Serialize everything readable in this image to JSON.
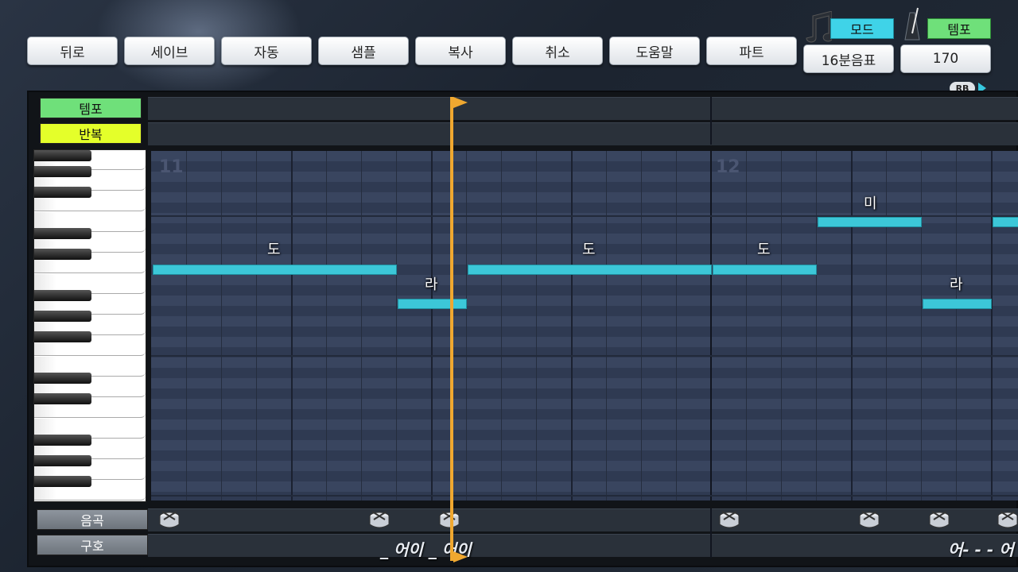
{
  "toolbar": {
    "buttons": [
      "뒤로",
      "세이브",
      "자동",
      "샘플",
      "복사",
      "취소",
      "도움말",
      "파트"
    ]
  },
  "mode": {
    "label": "모드",
    "value": "16분음표"
  },
  "tempo": {
    "label": "템포",
    "value": "170"
  },
  "rb_tag": "RB",
  "tracks": {
    "tempo_label": "템포",
    "repeat_label": "반복",
    "song_label": "음곡",
    "symbol_label": "구호"
  },
  "measures": [
    "11",
    "12"
  ],
  "notes": [
    {
      "label": "도",
      "color": "#3cc7d8"
    },
    {
      "label": "라",
      "color": "#3cc7d8"
    },
    {
      "label": "도",
      "color": "#3cc7d8"
    },
    {
      "label": "도",
      "color": "#3cc7d8"
    },
    {
      "label": "미",
      "color": "#3cc7d8"
    },
    {
      "label": "라",
      "color": "#3cc7d8"
    }
  ],
  "lyrics": [
    "_ 어이 _ 어이",
    "어- - - 어"
  ],
  "colors": {
    "accent_cyan": "#3fd3e8",
    "accent_green": "#6fe07a",
    "accent_yellow": "#e4ff2a",
    "playhead": "#f0a830"
  },
  "icons": [
    "note-icon",
    "metronome-icon",
    "drum-icon"
  ]
}
